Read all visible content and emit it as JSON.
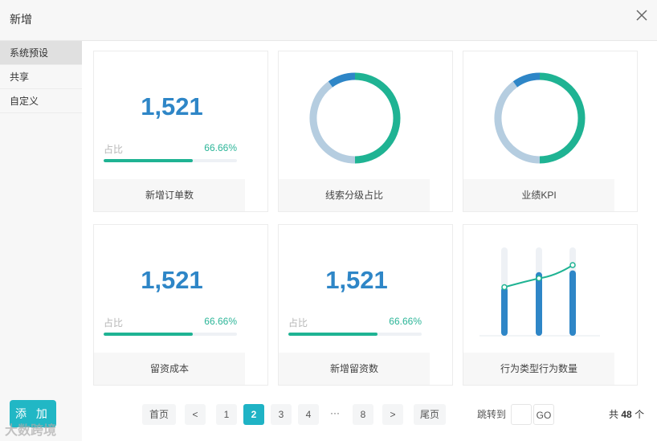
{
  "header": {
    "title": "新增",
    "close_icon": "close-icon"
  },
  "sidebar": {
    "items": [
      {
        "label": "系统预设",
        "active": true
      },
      {
        "label": "共享"
      },
      {
        "label": "自定义"
      }
    ]
  },
  "add_button": "添 加",
  "watermark": "大数跨境",
  "cards": [
    {
      "type": "number",
      "value": "1,521",
      "ratio_label": "占比",
      "ratio": "66.66%",
      "ratio_fraction": 0.6666,
      "title": "新增订单数"
    },
    {
      "type": "donut",
      "title": "线索分级占比",
      "segments": [
        {
          "fraction": 0.5,
          "color": "#1fb393"
        },
        {
          "fraction": 0.4,
          "color": "#b5cde0"
        },
        {
          "fraction": 0.1,
          "color": "#2e86c7"
        }
      ]
    },
    {
      "type": "donut",
      "title": "业绩KPI",
      "segments": [
        {
          "fraction": 0.5,
          "color": "#1fb393"
        },
        {
          "fraction": 0.4,
          "color": "#b5cde0"
        },
        {
          "fraction": 0.1,
          "color": "#2e86c7"
        }
      ]
    },
    {
      "type": "number",
      "value": "1,521",
      "ratio_label": "占比",
      "ratio": "66.66%",
      "ratio_fraction": 0.6666,
      "title": "留资成本"
    },
    {
      "type": "number",
      "value": "1,521",
      "ratio_label": "占比",
      "ratio": "66.66%",
      "ratio_fraction": 0.6666,
      "title": "新增留资数"
    },
    {
      "type": "barline",
      "title": "行为类型行为数量",
      "bars": [
        0.55,
        0.72,
        0.74
      ],
      "line": [
        0.55,
        0.65,
        0.8
      ]
    }
  ],
  "pagination": {
    "first": "首页",
    "prev": "<",
    "pages": [
      "1",
      "2",
      "3",
      "4"
    ],
    "ellipsis": "···",
    "last_page": "8",
    "next": ">",
    "last": "尾页",
    "current": "2",
    "jump_label": "跳转到",
    "jump_value": "",
    "go": "GO",
    "total_prefix": "共",
    "total_count": "48",
    "total_suffix": "个"
  },
  "colors": {
    "accent": "#1fb3c5",
    "number": "#2e86c7",
    "green": "#1fb393"
  }
}
